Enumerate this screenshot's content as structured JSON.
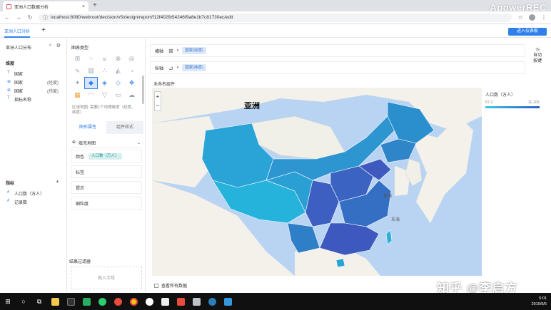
{
  "browser": {
    "tab_title": "亚洲人口数据分析",
    "tab_close": "×",
    "new_tab": "+",
    "url": "localhost:8080/webroot/decision/v5/design/report/f12f402fb54246f9a8e1b7c81730ec/edit",
    "watermark": "ApowerREC"
  },
  "app": {
    "tab_label": "亚洲人口分析",
    "add_label": "+",
    "enter_button": "进入仪表板"
  },
  "left_panel": {
    "title": "亚洲人口分布",
    "dimension_section": "维度",
    "dimensions": [
      {
        "type": "T",
        "name": "国家",
        "suffix": ""
      },
      {
        "type": "⊕",
        "name": "国家",
        "suffix": "(经度)"
      },
      {
        "type": "⊕",
        "name": "国家",
        "suffix": "(纬度)"
      },
      {
        "type": "T",
        "name": "指标名称",
        "suffix": ""
      }
    ],
    "measure_section": "指标",
    "measures": [
      {
        "type": "#",
        "name": "人口数（万人）"
      },
      {
        "type": "#",
        "name": "记录数"
      }
    ],
    "add": "+"
  },
  "mid_panel": {
    "title": "图表类型",
    "hint": "区域地图: 需要1个地理维度（经度、纬度）",
    "tabs": [
      "图形属性",
      "组件样式"
    ],
    "map_type": "填充地图",
    "rows": [
      {
        "label": "颜色",
        "pill": "人口数（万人）"
      },
      {
        "label": "标签",
        "pill": ""
      },
      {
        "label": "提示",
        "pill": ""
      },
      {
        "label": "细粒度",
        "pill": ""
      }
    ],
    "result_filter": "结果过滤器",
    "drop_hint": "拖入字段"
  },
  "shelves": {
    "x_label": "横轴",
    "x_pill": "国家(经度)",
    "y_label": "纵轴",
    "y_pill": "国家(纬度)",
    "auto_label_1": "自动",
    "auto_label_2": "按键"
  },
  "canvas": {
    "component_title": "未命名组件",
    "map_title": "亚洲",
    "zoom_in": "+",
    "zoom_out": "−",
    "sea_labels": [
      "黄海",
      "东海"
    ],
    "legend_title": "人口数（万人）",
    "legend_min": "67.2",
    "legend_max": "11,105",
    "show_all": "查看所有数据"
  },
  "watermark_bottom": "知乎 @李启方",
  "taskbar": {
    "time": "5:01",
    "date": "2019/9/5"
  },
  "colors": {
    "accent": "#2f80ed",
    "map_ocean": "#b9d4f2",
    "legend_low": "#41c4e0",
    "legend_high": "#2b60c4"
  }
}
